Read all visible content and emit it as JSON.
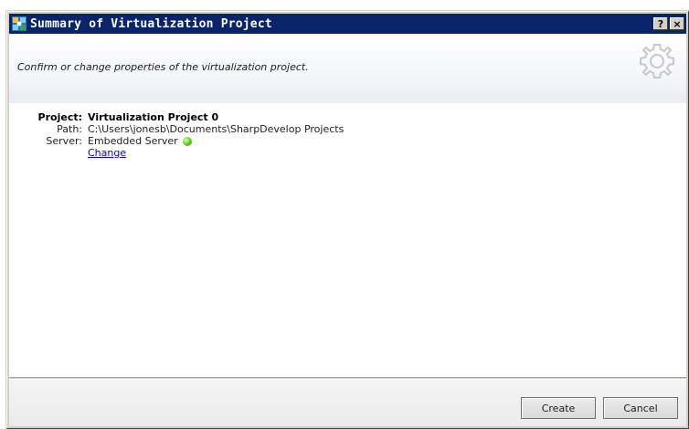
{
  "window": {
    "title": "Summary of Virtualization Project",
    "help_label": "?",
    "close_label": "×"
  },
  "header": {
    "subtitle": "Confirm or change properties of the virtualization project.",
    "icon": "gear-icon"
  },
  "properties": {
    "project_label": "Project:",
    "project_value": "Virtualization Project 0",
    "path_label": "Path:",
    "path_value": "C:\\Users\\jonesb\\Documents\\SharpDevelop Projects",
    "server_label": "Server:",
    "server_value": "Embedded Server",
    "server_status_color": "#3fae1a",
    "change_link": "Change"
  },
  "footer": {
    "create_label": "Create",
    "cancel_label": "Cancel"
  },
  "colors": {
    "titlebar": "#0a246a",
    "link": "#0000ee"
  }
}
